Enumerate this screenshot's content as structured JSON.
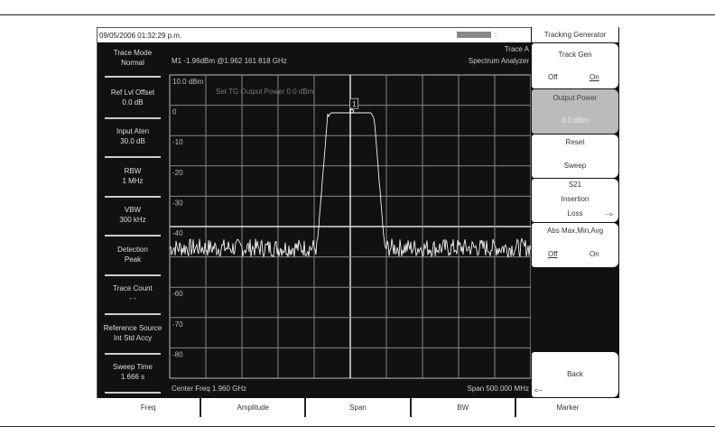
{
  "status_bar": {
    "datetime": "09/05/2006 01:32:29 p.m.",
    "colon": ":"
  },
  "header": {
    "trace": "Trace A",
    "mode": "Spectrum Analyzer",
    "marker_readout": "M1  -1.96dBm @1.962 161 818 GHz"
  },
  "graph": {
    "annotation": "Set TG Output Power 0.0 dBm",
    "marker_label": "1",
    "center_freq": "Center Freq 1.960 GHz",
    "span": "Span 500.000 MHz",
    "y_labels": [
      "10.0 dBm",
      "0",
      "-10",
      "-20",
      "-30",
      "-40",
      "",
      "-60",
      "-70",
      "-80"
    ]
  },
  "left_panel": [
    {
      "title": "Trace Mode",
      "value": "Normal"
    },
    {
      "title": "Ref Lvl Offset",
      "value": "0.0 dB"
    },
    {
      "title": "Input Aten",
      "value": "30.0 dB"
    },
    {
      "title": "RBW",
      "value": "1 MHz"
    },
    {
      "title": "VBW",
      "value": "300 kHz"
    },
    {
      "title": "Detection",
      "value": "Peak"
    },
    {
      "title": "Trace Count",
      "value": "- -"
    },
    {
      "title": "Reference Source",
      "value": "Int Std Accy"
    },
    {
      "title": "Sweep Time",
      "value": "1.666 s"
    }
  ],
  "right_menu": {
    "title": "Tracking Generator",
    "track_gen": {
      "label": "Track Gen",
      "off": "Off",
      "on": "On"
    },
    "output_power": {
      "label": "Output Power",
      "value": "0.0 dBm"
    },
    "reset_sweep": {
      "line1": "Reset",
      "line2": "Sweep"
    },
    "s21": {
      "line1": "S21",
      "line2": "Insertion",
      "line3": "Loss",
      "arrow": "-->"
    },
    "abs": {
      "label": "Abs Max,Min,Avg",
      "off": "Off",
      "on": "On"
    },
    "back": {
      "label": "Back",
      "arrow": "<--"
    }
  },
  "bottom_tabs": [
    "Freq",
    "Amplitude",
    "Span",
    "BW",
    "Marker"
  ],
  "chart_data": {
    "type": "line",
    "x_unit": "GHz",
    "y_unit": "dBm",
    "xlim": [
      1.71,
      2.21
    ],
    "ylim": [
      -90,
      10
    ],
    "noise_floor_dbm": -47,
    "noise_pp_db": 6,
    "passband_level_dbm": -2.5,
    "passband_top_ghz": [
      1.929,
      1.9925
    ],
    "passband_base_ghz": [
      1.914,
      2.0075
    ],
    "marker": {
      "freq_ghz": 1.962161818,
      "level_dbm": -1.96
    }
  }
}
